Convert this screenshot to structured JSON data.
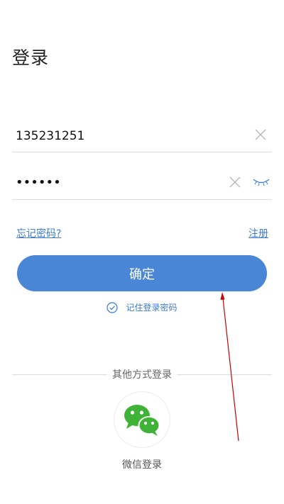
{
  "header": {
    "title": "登录"
  },
  "phone_field": {
    "value": "135231251"
  },
  "password_field": {
    "value": "••••••"
  },
  "links": {
    "forgot": "忘记密码?",
    "register": "注册"
  },
  "confirm_button": {
    "label": "确定"
  },
  "remember": {
    "label": "记住登录密码"
  },
  "other_login": {
    "label": "其他方式登录",
    "wechat_label": "微信登录"
  },
  "colors": {
    "accent": "#4a86d6",
    "link": "#3b7bd4",
    "wechat": "#3fb338",
    "annotation": "#cc0000"
  },
  "icons": {
    "clear": "close-icon",
    "eye": "eye-closed-icon",
    "check": "check-circle-icon",
    "wechat": "wechat-icon"
  }
}
